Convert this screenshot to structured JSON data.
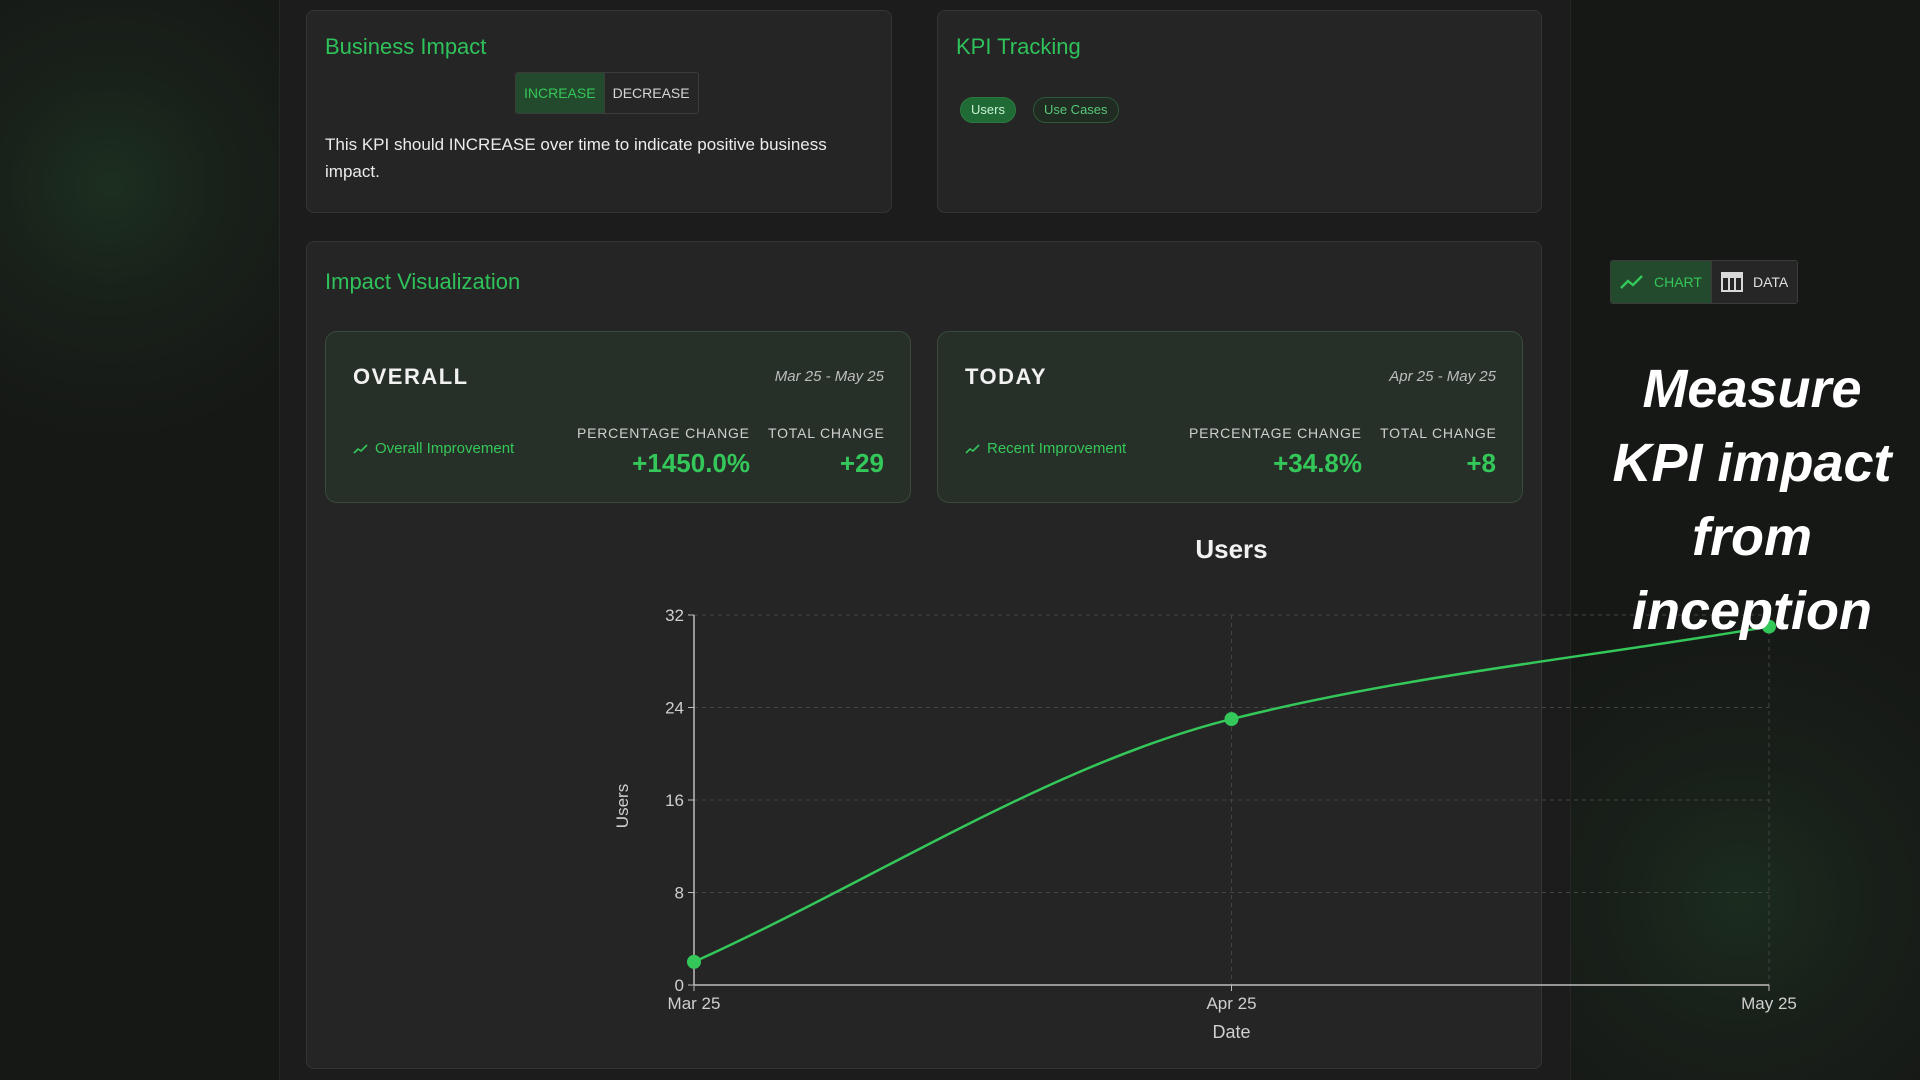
{
  "business_impact": {
    "title": "Business Impact",
    "toggle": {
      "increase": "INCREASE",
      "decrease": "DECREASE",
      "selected": "INCREASE"
    },
    "description": "This KPI should INCREASE over time to indicate positive business impact."
  },
  "kpi_tracking": {
    "title": "KPI Tracking",
    "chips": [
      {
        "label": "Users",
        "selected": true
      },
      {
        "label": "Use Cases",
        "selected": false
      }
    ]
  },
  "impact": {
    "title": "Impact Visualization",
    "view_toggle": {
      "chart": "CHART",
      "data": "DATA",
      "selected": "CHART"
    },
    "overall": {
      "heading": "OVERALL",
      "range": "Mar 25 - May 25",
      "improvement": "Overall Improvement",
      "pct_label": "PERCENTAGE CHANGE",
      "pct_value": "+1450.0%",
      "total_label": "TOTAL CHANGE",
      "total_value": "+29"
    },
    "today": {
      "heading": "TODAY",
      "range": "Apr 25 - May 25",
      "improvement": "Recent Improvement",
      "pct_label": "PERCENTAGE CHANGE",
      "pct_value": "+34.8%",
      "total_label": "TOTAL CHANGE",
      "total_value": "+8"
    }
  },
  "tagline": "Measure KPI impact from inception",
  "colors": {
    "accent": "#34c759",
    "panel": "#1c1c1c",
    "card": "#252525"
  },
  "chart_data": {
    "type": "line",
    "title": "Users",
    "xlabel": "Date",
    "ylabel": "Users",
    "categories": [
      "Mar 25",
      "Apr 25",
      "May 25"
    ],
    "series": [
      {
        "values": [
          2,
          23,
          31
        ]
      }
    ],
    "ylim": [
      0,
      32
    ],
    "yticks": [
      0,
      8,
      16,
      24,
      32
    ],
    "grid": true
  }
}
